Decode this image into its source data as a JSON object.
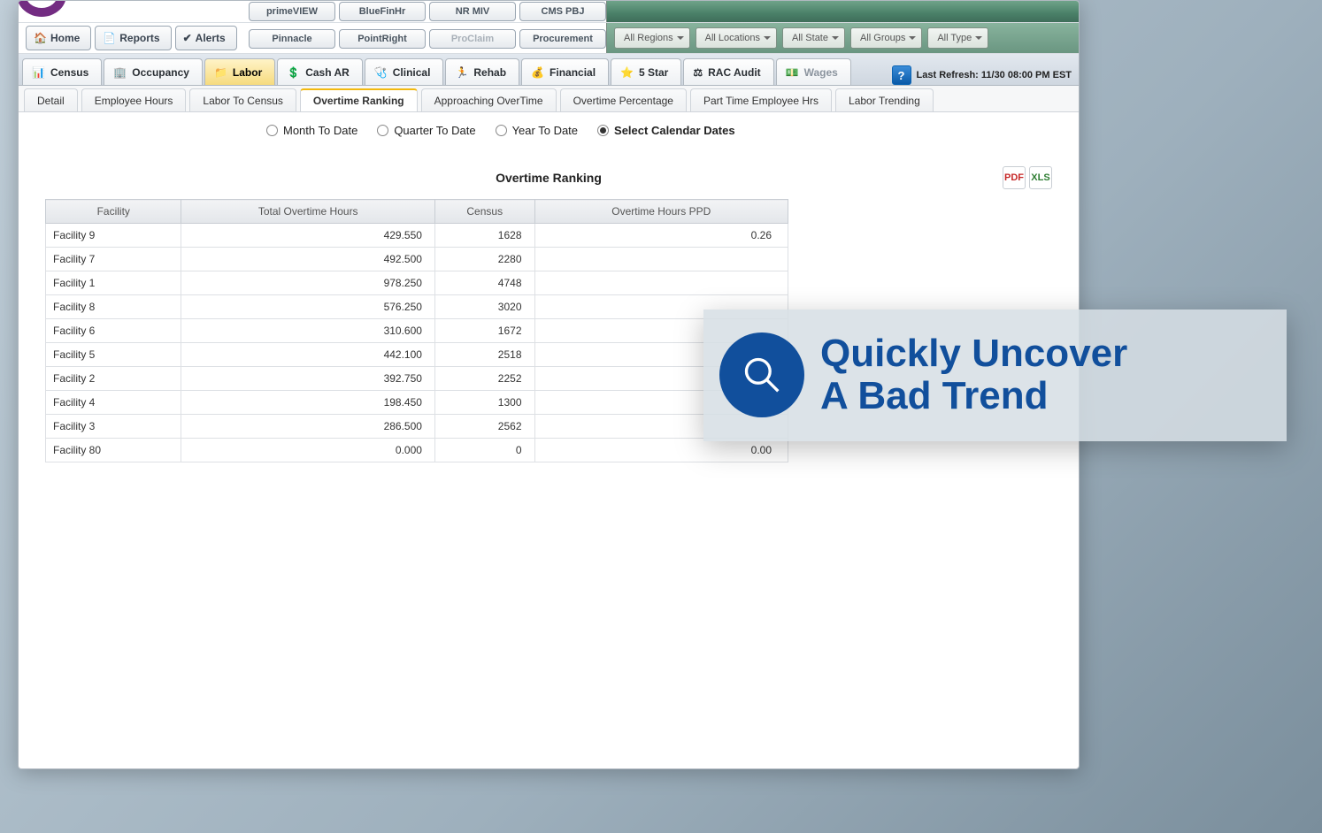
{
  "topButtons": {
    "row1": [
      "primeVIEW",
      "BlueFinHr",
      "NR MIV",
      "CMS PBJ"
    ],
    "row2": [
      "Pinnacle",
      "PointRight",
      "ProClaim",
      "Procurement"
    ],
    "disabledIndex": 2
  },
  "leftButtons": [
    "Home",
    "Reports",
    "Alerts"
  ],
  "filters": [
    "All Regions",
    "All Locations",
    "All State",
    "All Groups",
    "All Type"
  ],
  "navTabs": [
    {
      "label": "Census"
    },
    {
      "label": "Occupancy"
    },
    {
      "label": "Labor",
      "active": true
    },
    {
      "label": "Cash AR"
    },
    {
      "label": "Clinical"
    },
    {
      "label": "Rehab"
    },
    {
      "label": "Financial"
    },
    {
      "label": "5 Star"
    },
    {
      "label": "RAC Audit"
    },
    {
      "label": "Wages",
      "muted": true
    }
  ],
  "lastRefresh": "Last Refresh: 11/30 08:00 PM EST",
  "subTabs": [
    {
      "label": "Detail"
    },
    {
      "label": "Employee Hours"
    },
    {
      "label": "Labor To Census"
    },
    {
      "label": "Overtime Ranking",
      "active": true
    },
    {
      "label": "Approaching OverTime"
    },
    {
      "label": "Overtime Percentage"
    },
    {
      "label": "Part Time Employee Hrs"
    },
    {
      "label": "Labor Trending"
    }
  ],
  "dateOptions": [
    {
      "label": "Month To Date",
      "selected": false
    },
    {
      "label": "Quarter To Date",
      "selected": false
    },
    {
      "label": "Year To Date",
      "selected": false
    },
    {
      "label": "Select Calendar Dates",
      "selected": true
    }
  ],
  "report": {
    "title": "Overtime Ranking",
    "columns": [
      "Facility",
      "Total Overtime Hours",
      "Census",
      "Overtime Hours PPD"
    ],
    "rows": [
      {
        "facility": "Facility 9",
        "ot": "429.550",
        "census": "1628",
        "ppd": "0.26"
      },
      {
        "facility": "Facility 7",
        "ot": "492.500",
        "census": "2280",
        "ppd": ""
      },
      {
        "facility": "Facility 1",
        "ot": "978.250",
        "census": "4748",
        "ppd": ""
      },
      {
        "facility": "Facility 8",
        "ot": "576.250",
        "census": "3020",
        "ppd": ""
      },
      {
        "facility": "Facility 6",
        "ot": "310.600",
        "census": "1672",
        "ppd": ""
      },
      {
        "facility": "Facility 5",
        "ot": "442.100",
        "census": "2518",
        "ppd": ""
      },
      {
        "facility": "Facility 2",
        "ot": "392.750",
        "census": "2252",
        "ppd": ""
      },
      {
        "facility": "Facility 4",
        "ot": "198.450",
        "census": "1300",
        "ppd": ""
      },
      {
        "facility": "Facility 3",
        "ot": "286.500",
        "census": "2562",
        "ppd": ""
      },
      {
        "facility": "Facility 80",
        "ot": "0.000",
        "census": "0",
        "ppd": "0.00"
      }
    ]
  },
  "callout": {
    "line1": "Quickly Uncover",
    "line2": "A Bad Trend"
  }
}
